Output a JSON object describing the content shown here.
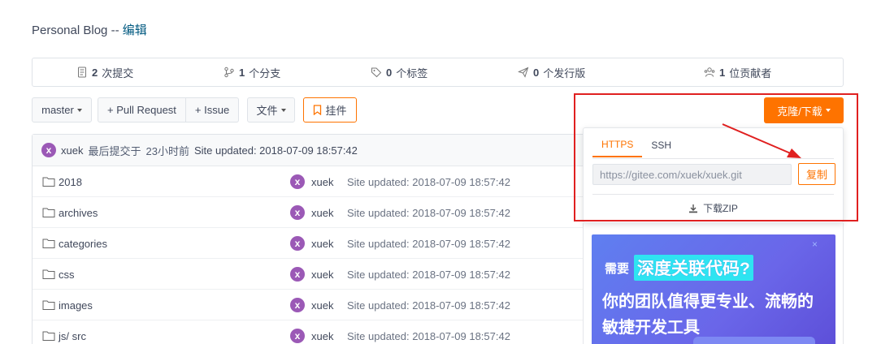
{
  "page": {
    "title": "Personal Blog",
    "title_sep": " -- ",
    "edit_link": "编辑"
  },
  "stats": {
    "commits": {
      "count": "2",
      "label": "次提交"
    },
    "branches": {
      "count": "1",
      "label": "个分支"
    },
    "tags": {
      "count": "0",
      "label": "个标签"
    },
    "releases": {
      "count": "0",
      "label": "个发行版"
    },
    "contributors": {
      "count": "1",
      "label": "位贡献者"
    }
  },
  "toolbar": {
    "branch": "master",
    "pull_request": "+ Pull Request",
    "issue": "+ Issue",
    "file": "文件",
    "plugin": "挂件",
    "clone": "克隆/下载"
  },
  "latest_commit": {
    "avatar_letter": "x",
    "author": "xuek",
    "prefix": "最后提交于",
    "time": "23小时前",
    "message": "Site updated: 2018-07-09 18:57:42"
  },
  "files": [
    {
      "name": "2018",
      "author": "xuek",
      "avatar": "x",
      "message": "Site updated: 2018-07-09 18:57:42"
    },
    {
      "name": "archives",
      "author": "xuek",
      "avatar": "x",
      "message": "Site updated: 2018-07-09 18:57:42"
    },
    {
      "name": "categories",
      "author": "xuek",
      "avatar": "x",
      "message": "Site updated: 2018-07-09 18:57:42"
    },
    {
      "name": "css",
      "author": "xuek",
      "avatar": "x",
      "message": "Site updated: 2018-07-09 18:57:42"
    },
    {
      "name": "images",
      "author": "xuek",
      "avatar": "x",
      "message": "Site updated: 2018-07-09 18:57:42"
    },
    {
      "name": "js/ src",
      "author": "xuek",
      "avatar": "x",
      "message": "Site updated: 2018-07-09 18:57:42"
    }
  ],
  "clone_dropdown": {
    "tab_https": "HTTPS",
    "tab_ssh": "SSH",
    "url": "https://gitee.com/xuek/xuek.git",
    "copy": "复制",
    "download_zip": "下载ZIP"
  },
  "ad": {
    "need": "需要",
    "highlight": "深度关联代码?",
    "line2": "你的团队值得更专业、流畅的",
    "line3": "敏捷开发工具",
    "close": "×"
  },
  "colors": {
    "accent": "#fe7300",
    "annotation": "#e02020",
    "avatar": "#9b59b6"
  }
}
